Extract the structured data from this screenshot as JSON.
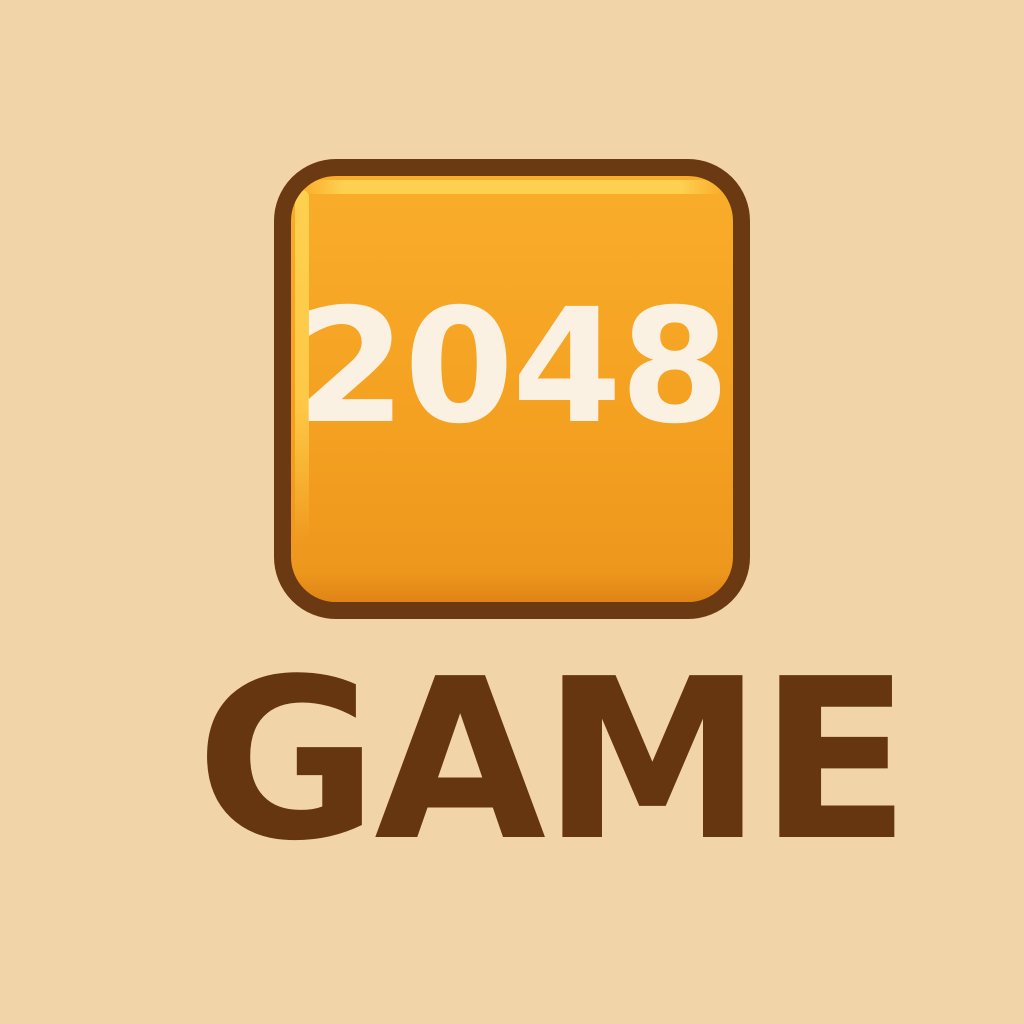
{
  "logo": {
    "tile_value": "2048",
    "title": "GAME"
  },
  "colors": {
    "background": "#f1d4a7",
    "tile_fill": "#f4a020",
    "tile_border": "#6b3a12",
    "tile_text": "#fbf1e2",
    "title_text": "#65360f"
  }
}
